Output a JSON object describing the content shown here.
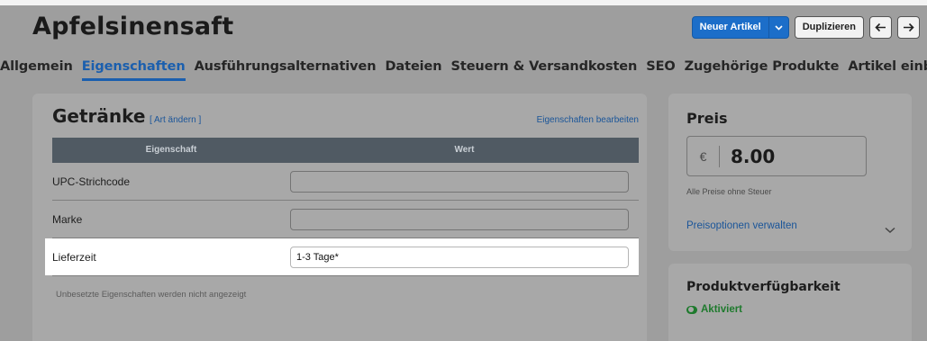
{
  "header": {
    "title": "Apfelsinensaft",
    "new_article_label": "Neuer Artikel",
    "duplicate_label": "Duplizieren"
  },
  "tabs": [
    {
      "label": "Allgemein",
      "active": false
    },
    {
      "label": "Eigenschaften",
      "active": true
    },
    {
      "label": "Ausführungsalternativen",
      "active": false
    },
    {
      "label": "Dateien",
      "active": false
    },
    {
      "label": "Steuern & Versandkosten",
      "active": false
    },
    {
      "label": "SEO",
      "active": false
    },
    {
      "label": "Zugehörige Produkte",
      "active": false
    },
    {
      "label": "Artikel einbinden",
      "active": false
    }
  ],
  "properties": {
    "title": "Getränke",
    "change_type_link": "[ Art ändern ]",
    "edit_link": "Eigenschaften bearbeiten",
    "columns": [
      "Eigenschaft",
      "Wert"
    ],
    "rows": [
      {
        "label": "UPC-Strichcode",
        "value": ""
      },
      {
        "label": "Marke",
        "value": ""
      },
      {
        "label": "Lieferzeit",
        "value": "1-3 Tage*"
      }
    ],
    "note": "Unbesetzte Eigenschaften werden nicht angezeigt"
  },
  "price": {
    "title": "Preis",
    "currency_symbol": "€",
    "value": "8.00",
    "note": "Alle Preise ohne Steuer",
    "options_link": "Preisoptionen verwalten"
  },
  "availability": {
    "title": "Produktverfügbarkeit",
    "status": "Aktiviert"
  },
  "colors": {
    "primary": "#1c6ec9",
    "link": "#1a5599",
    "active_tab": "#1b5fae",
    "table_header": "#505a63",
    "status_green": "#1e7a2d"
  }
}
